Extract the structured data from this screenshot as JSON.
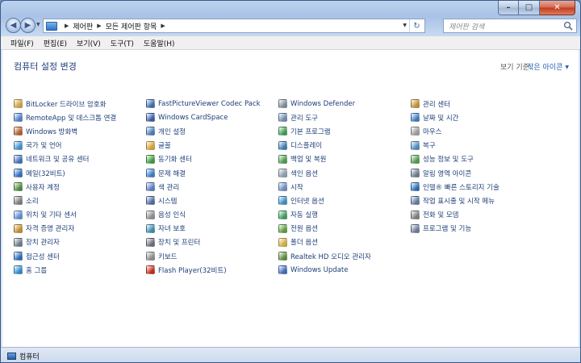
{
  "window": {
    "caption": {
      "minimize": "–",
      "maximize": "□",
      "close": "✕"
    }
  },
  "address": {
    "crumbs": [
      "제어판",
      "모든 제어판 항목"
    ],
    "search_placeholder": "제어판 검색"
  },
  "menu": [
    "파일(F)",
    "편집(E)",
    "보기(V)",
    "도구(T)",
    "도움말(H)"
  ],
  "content": {
    "title": "컴퓨터 설정 변경",
    "view_by_label": "보기 기준:",
    "view_by_value": "작은 아이콘"
  },
  "items": [
    {
      "label": "BitLocker 드라이브 암호화",
      "color": "#c9a23a"
    },
    {
      "label": "RemoteApp 및 데스크톱 연결",
      "color": "#4d7fc9"
    },
    {
      "label": "Windows 방화벽",
      "color": "#b35a2a"
    },
    {
      "label": "국가 및 언어",
      "color": "#3f8fd0"
    },
    {
      "label": "네트워크 및 공유 센터",
      "color": "#3d6fb8"
    },
    {
      "label": "메일(32비트)",
      "color": "#2f6fc0"
    },
    {
      "label": "사용자 계정",
      "color": "#4a8a3a"
    },
    {
      "label": "소리",
      "color": "#7a7a7a"
    },
    {
      "label": "위치 및 기타 센서",
      "color": "#5a8fd0"
    },
    {
      "label": "자격 증명 관리자",
      "color": "#c08a2a"
    },
    {
      "label": "장치 관리자",
      "color": "#6a7a8a"
    },
    {
      "label": "접근성 센터",
      "color": "#2a6ab8"
    },
    {
      "label": "홈 그룹",
      "color": "#2a8ac8"
    },
    {
      "label": "FastPictureViewer Codec Pack",
      "color": "#3a6ab0"
    },
    {
      "label": "Windows CardSpace",
      "color": "#3a5aa8"
    },
    {
      "label": "개인 설정",
      "color": "#4a7ab8"
    },
    {
      "label": "글꼴",
      "color": "#d0a030"
    },
    {
      "label": "동기화 센터",
      "color": "#3a9a3a"
    },
    {
      "label": "문제 해결",
      "color": "#3a7ac0"
    },
    {
      "label": "색 관리",
      "color": "#5a7ac0"
    },
    {
      "label": "시스템",
      "color": "#4a6aa0"
    },
    {
      "label": "음성 인식",
      "color": "#8a8a8a"
    },
    {
      "label": "자녀 보호",
      "color": "#3a8ab0"
    },
    {
      "label": "장치 및 프린터",
      "color": "#6a6a7a"
    },
    {
      "label": "키보드",
      "color": "#8a8a8a"
    },
    {
      "label": "Flash Player(32비트)",
      "color": "#c02a1a"
    },
    {
      "label": "Windows Defender",
      "color": "#7a8a9a"
    },
    {
      "label": "관리 도구",
      "color": "#6a8ab0"
    },
    {
      "label": "기본 프로그램",
      "color": "#3a9a4a"
    },
    {
      "label": "디스플레이",
      "color": "#3a7ab0"
    },
    {
      "label": "백업 및 복원",
      "color": "#4a9a4a"
    },
    {
      "label": "색인 옵션",
      "color": "#8a9aaa"
    },
    {
      "label": "시작",
      "color": "#6a8ac0"
    },
    {
      "label": "인터넷 옵션",
      "color": "#3a8ac0"
    },
    {
      "label": "자동 실행",
      "color": "#3a9a5a"
    },
    {
      "label": "전원 옵션",
      "color": "#5a9a3a"
    },
    {
      "label": "폴더 옵션",
      "color": "#d0aa3a"
    },
    {
      "label": "Realtek HD 오디오 관리자",
      "color": "#5a8a3a"
    },
    {
      "label": "Windows Update",
      "color": "#3a6ab8"
    },
    {
      "label": "관리 센터",
      "color": "#c0902a"
    },
    {
      "label": "날짜 및 시간",
      "color": "#3a7ac0"
    },
    {
      "label": "마우스",
      "color": "#9a9a9a"
    },
    {
      "label": "복구",
      "color": "#4a8ac0"
    },
    {
      "label": "성능 정보 및 도구",
      "color": "#4a9a4a"
    },
    {
      "label": "알림 영역 아이콘",
      "color": "#6a7a8a"
    },
    {
      "label": "인텔® 빠른 스토리지 기술",
      "color": "#2a6ab8"
    },
    {
      "label": "작업 표시줄 및 시작 메뉴",
      "color": "#5a7aa0"
    },
    {
      "label": "전화 및 모뎀",
      "color": "#7a7a7a"
    },
    {
      "label": "프로그램 및 기능",
      "color": "#6a7a9a"
    }
  ],
  "status": {
    "text": "컴퓨터"
  }
}
